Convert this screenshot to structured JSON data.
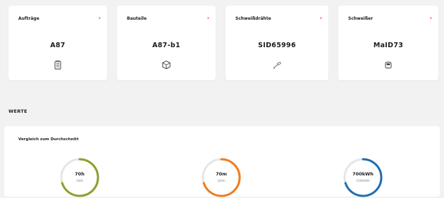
{
  "cards": [
    {
      "title": "Aufträge",
      "value": "A87",
      "icon": "clipboard-icon"
    },
    {
      "title": "Bauteile",
      "value": "A87-b1",
      "icon": "cube-icon"
    },
    {
      "title": "Schweißdrähte",
      "value": "SID65996",
      "icon": "welding-wire-icon"
    },
    {
      "title": "Schweißer",
      "value": "MaID73",
      "icon": "welding-helmet-icon"
    }
  ],
  "chevron": "›",
  "section": {
    "title": "WERTE"
  },
  "comparison": {
    "subtitle": "Vergleich zum Durchschnitt",
    "gauges": [
      {
        "value": "70h",
        "sub": "100h",
        "fraction": 0.7,
        "color": "#8aa12a"
      },
      {
        "value": "70m",
        "sub": "100m",
        "fraction": 0.7,
        "color": "#f07c1b"
      },
      {
        "value": "700kWh",
        "sub": "1000kWh",
        "fraction": 0.7,
        "color": "#1f6db3"
      }
    ]
  },
  "colors": {
    "accent": "#e8412c"
  }
}
